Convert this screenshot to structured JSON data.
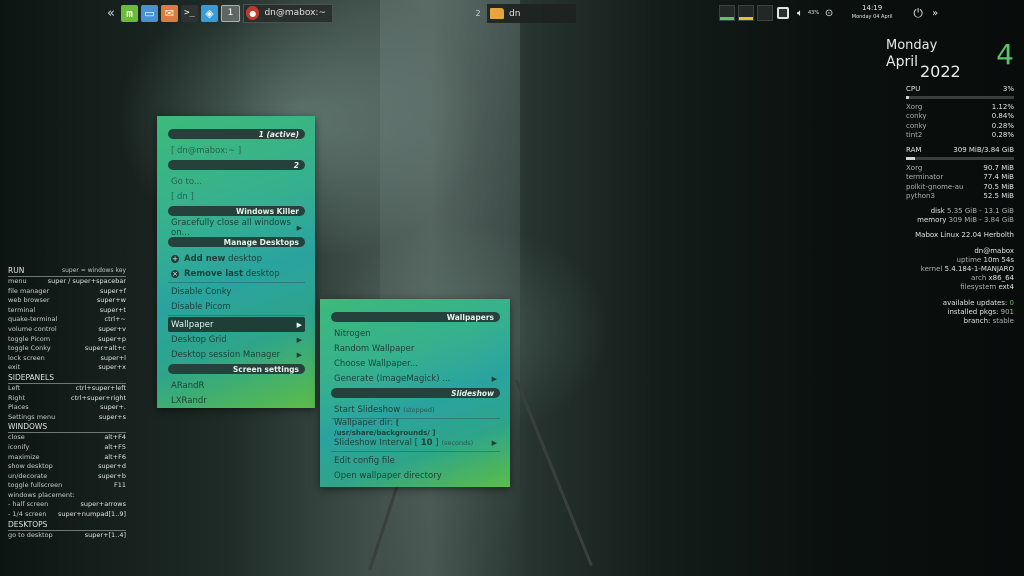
{
  "panel": {
    "left": {
      "collapse": "«",
      "mint": "m",
      "terminal": ">_",
      "workspace": "1",
      "task_title": "dn@mabox:~"
    },
    "middle": {
      "workspace_num": "2",
      "task_title": "dn"
    },
    "right": {
      "volume_label": "43%",
      "time": "14:19",
      "date": "Monday 04 April",
      "more": "»"
    }
  },
  "calendar": {
    "weekday": "Monday",
    "month": "April",
    "year": "2022",
    "day": "4"
  },
  "system": {
    "cpu_label": "CPU",
    "cpu_value": "3%",
    "cpu_fill": 0.03,
    "cpu_procs": [
      {
        "name": "Xorg",
        "value": "1.12%"
      },
      {
        "name": "conky",
        "value": "0.84%"
      },
      {
        "name": "conky",
        "value": "0.28%"
      },
      {
        "name": "tint2",
        "value": "0.28%"
      }
    ],
    "ram_label": "RAM",
    "ram_value": "309 MiB/3.84 GiB",
    "ram_fill": 0.08,
    "ram_procs": [
      {
        "name": "Xorg",
        "value": "90.7 MiB"
      },
      {
        "name": "terminator",
        "value": "77.4 MiB"
      },
      {
        "name": "polkit-gnome-au",
        "value": "70.5 MiB"
      },
      {
        "name": "python3",
        "value": "52.5 MiB"
      }
    ],
    "disk_label": "disk",
    "disk_value": "5.35 GiB - 13.1 GiB",
    "memory_label": "memory",
    "memory_value": "309 MiB - 3.84 GiB",
    "distro": "Mabox Linux 22.04 Herbolth",
    "user": "dn@mabox",
    "uptime_label": "uptime",
    "uptime_value": "10m 54s",
    "kernel_label": "kernel",
    "kernel_value": "5.4.184-1-MANJARO",
    "arch_label": "arch",
    "arch_value": "x86_64",
    "fs_label": "filesystem",
    "fs_value": "ext4",
    "updates_label": "available updates:",
    "updates_value": "0",
    "pkgs_label": "installed pkgs:",
    "pkgs_value": "901",
    "branch_label": "branch:",
    "branch_value": "stable"
  },
  "keybinds": {
    "run_title": "RUN",
    "run_hint": "super = windows key",
    "run": [
      {
        "k": "menu",
        "v": "super / super+spacebar"
      },
      {
        "k": "file manager",
        "v": "super+f"
      },
      {
        "k": "web browser",
        "v": "super+w"
      },
      {
        "k": "terminal",
        "v": "super+t"
      },
      {
        "k": "quake-terminal",
        "v": "ctrl+~"
      },
      {
        "k": "volume control",
        "v": "super+v"
      },
      {
        "k": "toggle Picom",
        "v": "super+p"
      },
      {
        "k": "toggle Conky",
        "v": "super+alt+c"
      },
      {
        "k": "lock screen",
        "v": "super+l"
      },
      {
        "k": "exit",
        "v": "super+x"
      }
    ],
    "sidepanels_title": "SIDEPANELS",
    "sidepanels": [
      {
        "k": "Left",
        "v": "ctrl+super+left"
      },
      {
        "k": "Right",
        "v": "ctrl+super+right"
      },
      {
        "k": "Places",
        "v": "super+."
      },
      {
        "k": "Settings menu",
        "v": "super+s"
      }
    ],
    "windows_title": "WINDOWS",
    "windows": [
      {
        "k": "close",
        "v": "alt+F4"
      },
      {
        "k": "iconify",
        "v": "alt+F5"
      },
      {
        "k": "maximize",
        "v": "alt+F6"
      },
      {
        "k": "show desktop",
        "v": "super+d"
      },
      {
        "k": "un/decorate",
        "v": "super+b"
      },
      {
        "k": "toggle fullscreen",
        "v": "F11"
      },
      {
        "k": "windows placement:",
        "v": ""
      },
      {
        "k": " - half screen",
        "v": "super+arrows"
      },
      {
        "k": " - 1/4 screen",
        "v": "super+numpad[1..9]"
      }
    ],
    "desktops_title": "DESKTOPS",
    "desktops": [
      {
        "k": "go to desktop",
        "v": "super+[1..4]"
      }
    ]
  },
  "menu1": {
    "head1": "1 (active)",
    "item_term": "[ dn@mabox:~ ]",
    "head2": "2",
    "item_goto": "Go to...",
    "item_dn": "[ dn ]",
    "head_killer": "Windows Killer",
    "item_close_all": "Gracefully close all windows on...",
    "head_manage": "Manage Desktops",
    "add_new_bold": "Add new",
    "add_new_rest": " desktop",
    "remove_bold": "Remove last",
    "remove_rest": " desktop",
    "item_disable_conky": "Disable Conky",
    "item_disable_picom": "Disable Picom",
    "item_wallpaper": "Wallpaper",
    "item_desktop_grid": "Desktop Grid",
    "item_session": "Desktop session Manager",
    "head_screen": "Screen settings",
    "item_arandr": "ARandR",
    "item_lxrandr": "LXRandr"
  },
  "menu2": {
    "head_wallpapers": "Wallpapers",
    "item_nitrogen": "Nitrogen",
    "item_random": "Random Wallpaper",
    "item_choose": "Choose Wallpaper...",
    "item_generate": "Generate (ImageMagick) ...",
    "head_slideshow": "Slideshow",
    "item_start": "Start Slideshow",
    "item_start_sub": "(stopped)",
    "item_dir": "Wallpaper dir:",
    "item_dir_val": "[ /usr/share/backgrounds/ ]",
    "item_interval": "Slideshow Interval [",
    "item_interval_val": "10",
    "item_interval_end": "]",
    "item_interval_sub": "(seconds)",
    "item_edit": "Edit config file",
    "item_open": "Open wallpaper directory"
  }
}
